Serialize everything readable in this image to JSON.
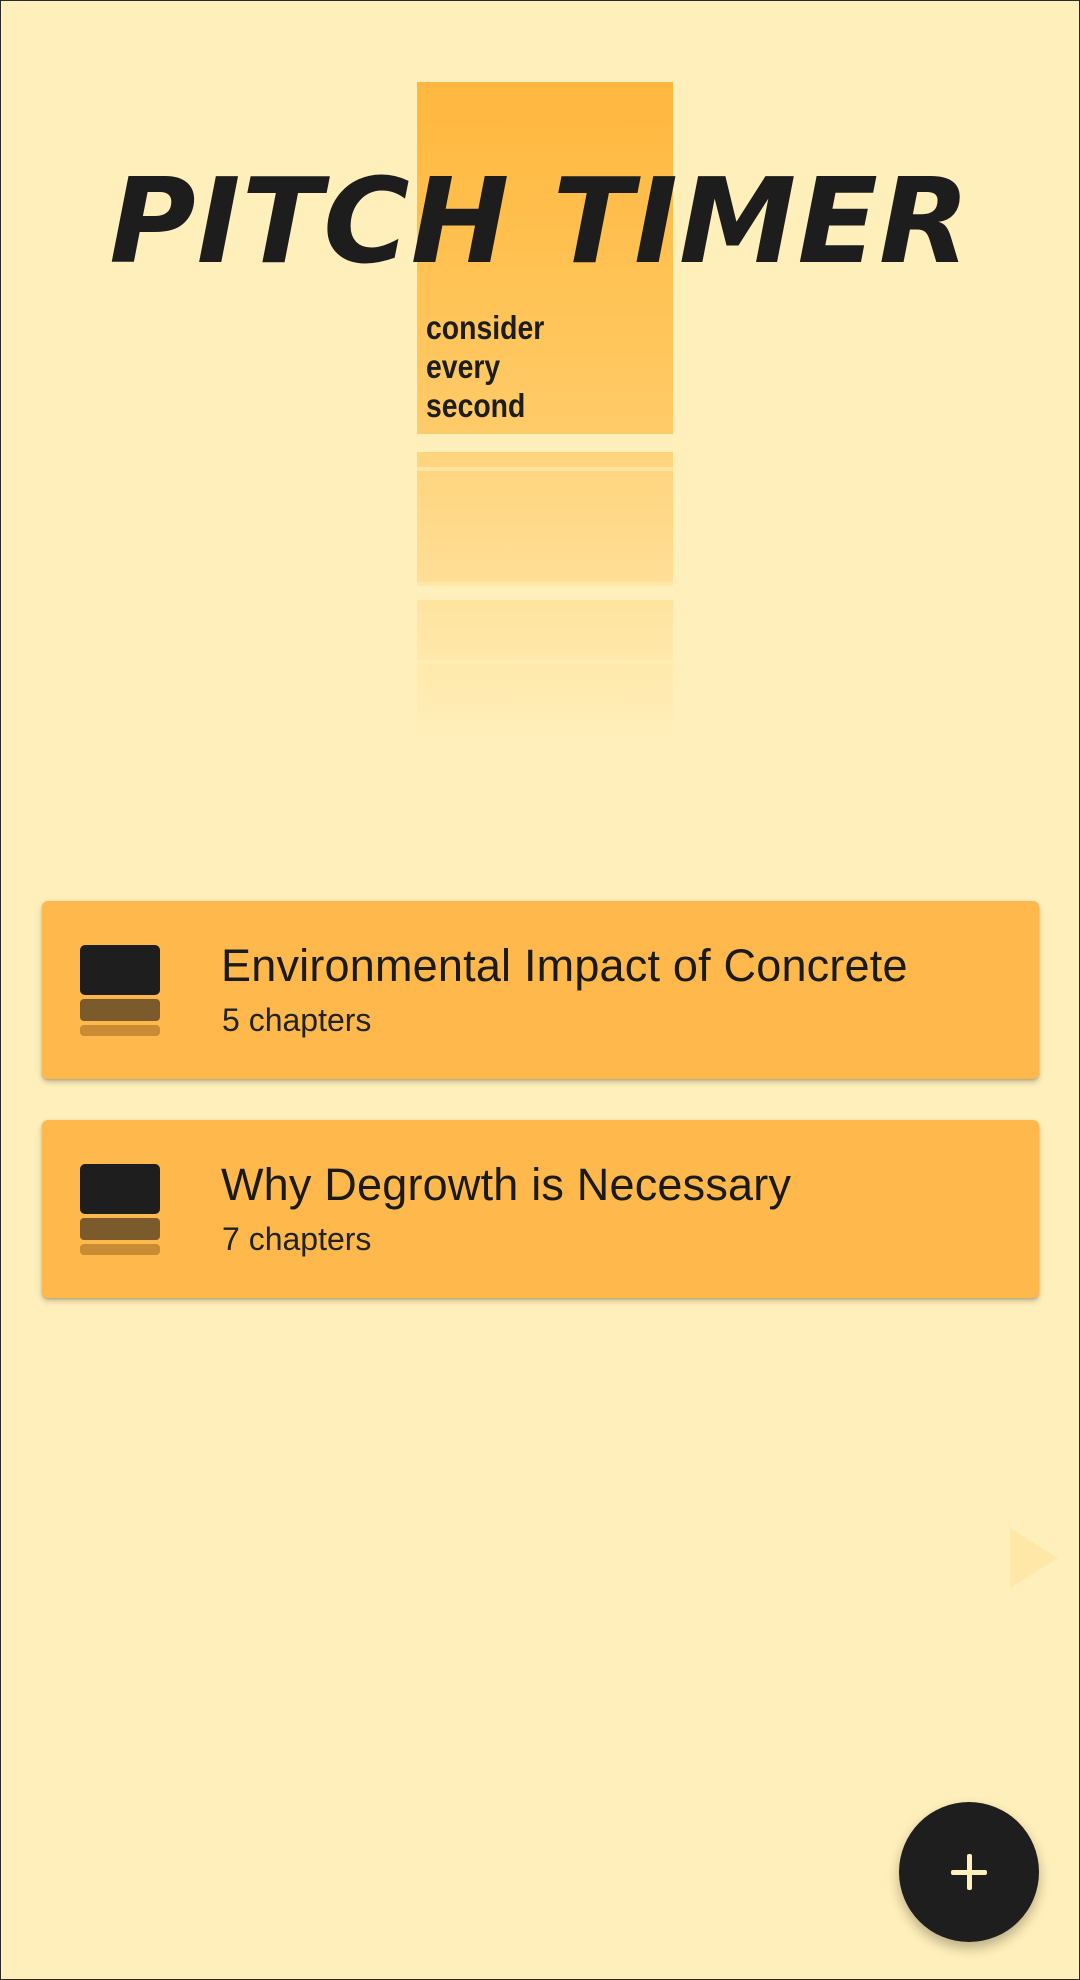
{
  "app": {
    "title": "PITCH TIMER",
    "tagline": [
      "consider",
      "every",
      "second"
    ]
  },
  "projects": [
    {
      "title": "Environmental Impact of Concrete",
      "subtitle": "5 chapters",
      "icon": "stack-icon"
    },
    {
      "title": "Why Degrowth is Necessary",
      "subtitle": "7 chapters",
      "icon": "stack-icon"
    }
  ],
  "fab": {
    "icon": "plus-icon"
  },
  "colors": {
    "background": "#FFEFBA",
    "accent": "#FFB84C",
    "dark": "#1E1E1E"
  }
}
